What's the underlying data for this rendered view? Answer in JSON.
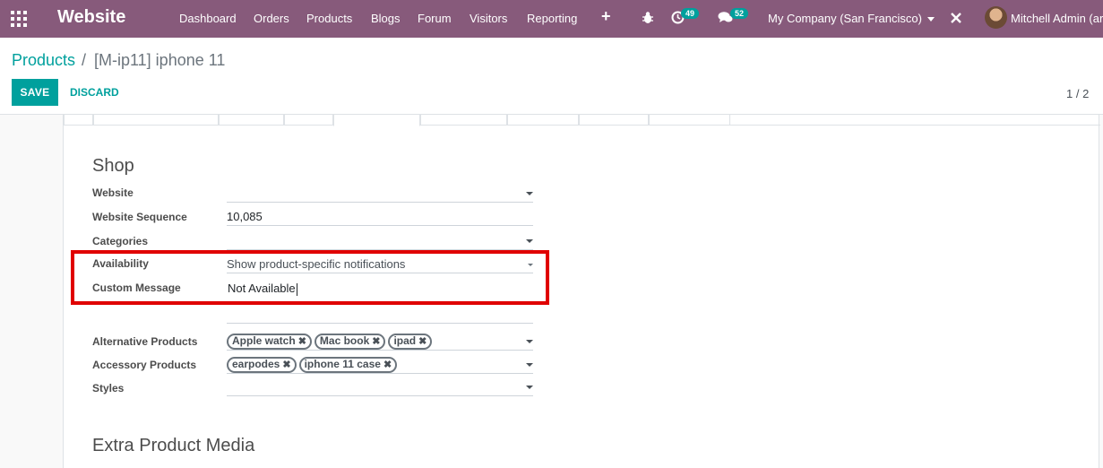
{
  "navbar": {
    "app_title": "Website",
    "menu": [
      "Dashboard",
      "Orders",
      "Products",
      "Blogs",
      "Forum",
      "Visitors",
      "Reporting"
    ],
    "add_icon": "+",
    "activity_count": "49",
    "messages_count": "52",
    "company": "My Company (San Francisco)",
    "user": "Mitchell Admin (ar",
    "accent_color": "#875a7b",
    "badge_color": "#00a09d"
  },
  "control_panel": {
    "breadcrumb_root": "Products",
    "breadcrumb_sep": "/",
    "breadcrumb_current": "[M-ip11] iphone 11",
    "save_label": "SAVE",
    "discard_label": "DISCARD",
    "pager": "1 / 2"
  },
  "shop": {
    "title": "Shop",
    "website_label": "Website",
    "website_value": "",
    "sequence_label": "Website Sequence",
    "sequence_value": "10,085",
    "categories_label": "Categories",
    "categories_value": "",
    "availability_label": "Availability",
    "availability_value": "Show product-specific notifications",
    "custom_message_label": "Custom Message",
    "custom_message_value": "Not Available",
    "alternative_label": "Alternative Products",
    "alternative_tags": [
      "Apple watch",
      "Mac book",
      "ipad"
    ],
    "accessory_label": "Accessory Products",
    "accessory_tags": [
      "earpodes",
      "iphone 11 case"
    ],
    "styles_label": "Styles",
    "styles_value": ""
  },
  "extra_media": {
    "title": "Extra Product Media"
  }
}
